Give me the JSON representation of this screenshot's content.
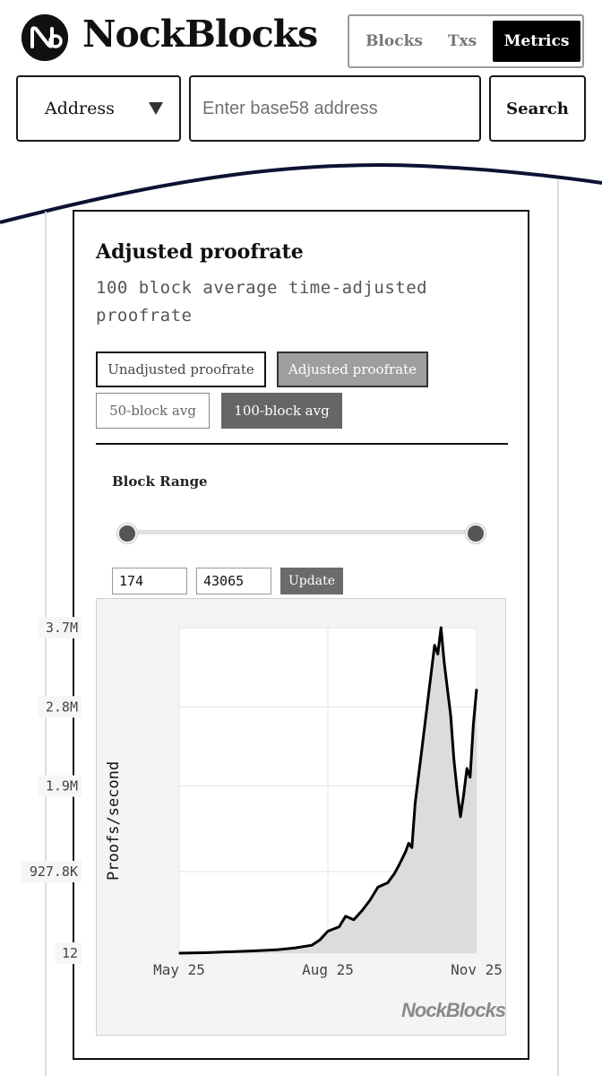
{
  "header": {
    "brand": "NockBlocks",
    "nav": {
      "blocks": "Blocks",
      "txs": "Txs",
      "metrics": "Metrics",
      "active": "Metrics"
    },
    "logo_icon": "nock-logo-icon"
  },
  "search": {
    "type_selected": "Address",
    "placeholder": "Enter base58 address",
    "value": "",
    "button": "Search"
  },
  "card": {
    "title": "Adjusted proofrate",
    "subtitle": "100 block average time-adjusted proofrate",
    "metric_toggles": [
      {
        "label": "Unadjusted proofrate",
        "active": false
      },
      {
        "label": "Adjusted proofrate",
        "active": true
      }
    ],
    "window_toggles": [
      {
        "label": "50-block avg",
        "active": false
      },
      {
        "label": "100-block avg",
        "active": true
      }
    ],
    "block_range": {
      "label": "Block Range",
      "min": "174",
      "max": "43065",
      "slider_min_fraction": 0,
      "slider_max_fraction": 1,
      "update_label": "Update"
    },
    "watermark": "NockBlocks"
  },
  "chart_data": {
    "type": "area",
    "title": "",
    "xlabel": "",
    "ylabel": "Proofs/second",
    "y_tick_labels": [
      "3.7M",
      "2.8M",
      "1.9M",
      "927.8K",
      "12"
    ],
    "y_tick_values": [
      3700000,
      2800000,
      1900000,
      927800,
      12
    ],
    "x_tick_labels": [
      "May 25",
      "Aug 25",
      "Nov 25"
    ],
    "x_tick_values": [
      "2025-05-25",
      "2025-08-25",
      "2025-11-25"
    ],
    "xlim": [
      "2025-05-25",
      "2025-11-25"
    ],
    "ylim": [
      12,
      3700000
    ],
    "grid": true,
    "series": [
      {
        "x": [
          "2025-05-25",
          "2025-06-10",
          "2025-06-25",
          "2025-07-10",
          "2025-07-25",
          "2025-08-05",
          "2025-08-15",
          "2025-08-20",
          "2025-08-25",
          "2025-09-01",
          "2025-09-05",
          "2025-09-10",
          "2025-09-15",
          "2025-09-20",
          "2025-09-25",
          "2025-10-01",
          "2025-10-05",
          "2025-10-08",
          "2025-10-12",
          "2025-10-14",
          "2025-10-16",
          "2025-10-18",
          "2025-10-20",
          "2025-10-22",
          "2025-10-24",
          "2025-10-26",
          "2025-10-28",
          "2025-10-30",
          "2025-11-01",
          "2025-11-03",
          "2025-11-05",
          "2025-11-07",
          "2025-11-09",
          "2025-11-11",
          "2025-11-13",
          "2025-11-15",
          "2025-11-17",
          "2025-11-19",
          "2025-11-21",
          "2025-11-23",
          "2025-11-25"
        ],
        "values": [
          12,
          5000,
          15000,
          25000,
          40000,
          60000,
          90000,
          150000,
          250000,
          300000,
          420000,
          380000,
          480000,
          600000,
          750000,
          800000,
          900000,
          1000000,
          1150000,
          1250000,
          1200000,
          1700000,
          2000000,
          2300000,
          2600000,
          2900000,
          3200000,
          3500000,
          3400000,
          3700000,
          3300000,
          3000000,
          2700000,
          2200000,
          1850000,
          1550000,
          1800000,
          2100000,
          2000000,
          2600000,
          3000000
        ]
      }
    ],
    "colors": {
      "line": "#000000",
      "fill": "#dcdcdc",
      "grid": "#e3e3e3",
      "plot_bg": "#ffffff"
    }
  }
}
